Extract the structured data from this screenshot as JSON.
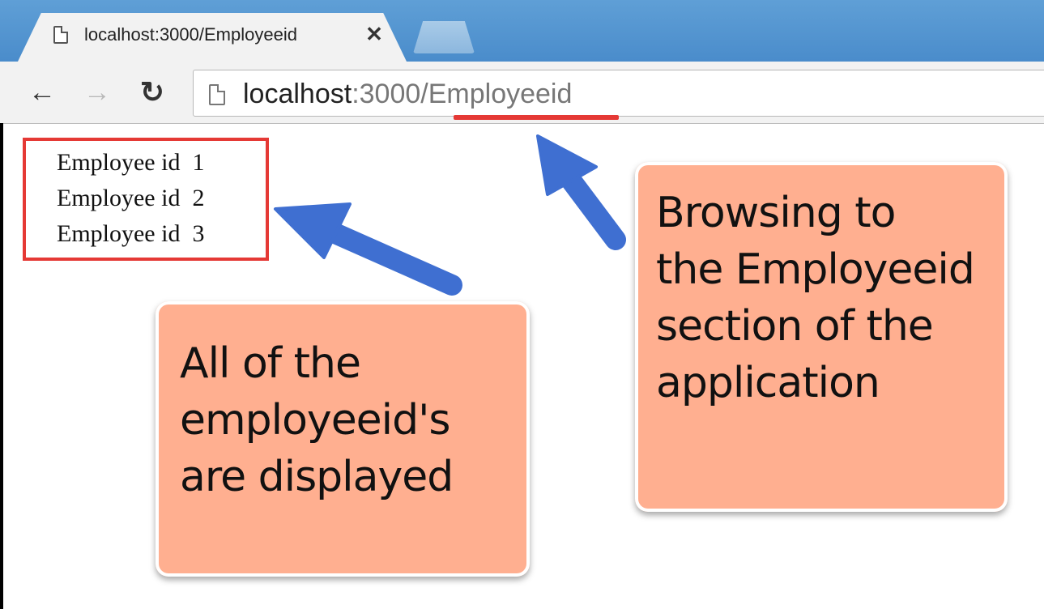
{
  "tab": {
    "title": "localhost:3000/Employeeid",
    "close_glyph": "✕",
    "page_icon": "page-icon"
  },
  "toolbar": {
    "back_glyph": "←",
    "forward_glyph": "→",
    "reload_glyph": "↻"
  },
  "address_bar": {
    "url_host": "localhost",
    "url_rest": ":3000/Employeeid",
    "icon": "page-icon"
  },
  "employees": [
    "Employee id  1",
    "Employee id  2",
    "Employee id  3"
  ],
  "callouts": {
    "left": "All of the\nemployeeid's\nare displayed",
    "right": "Browsing to\nthe Employeeid\nsection of the\napplication"
  },
  "colors": {
    "highlight_red": "#e53935",
    "callout_fill": "#ffaf90",
    "arrow_blue": "#3f6fd1",
    "tabstrip_blue": "#4a8ccb"
  }
}
